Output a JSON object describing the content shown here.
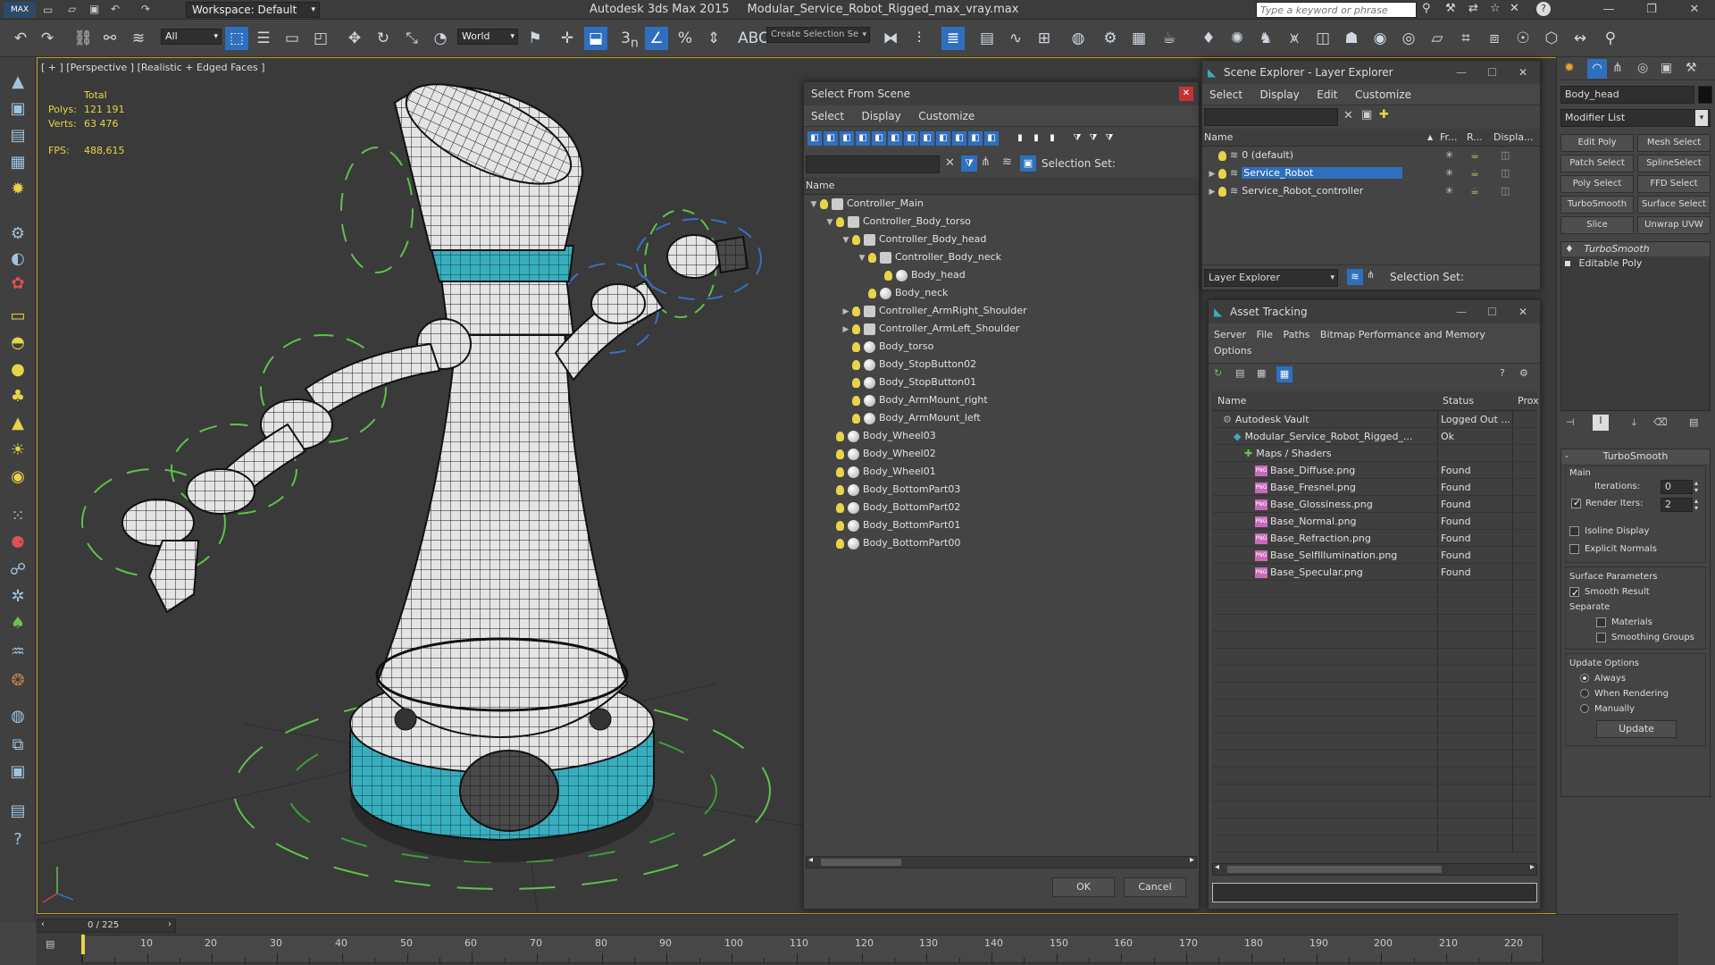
{
  "app": {
    "workspace_label": "Workspace: Default",
    "title": "Autodesk 3ds Max  2015",
    "filename": "Modular_Service_Robot_Rigged_max_vray.max",
    "search_placeholder": "Type a keyword or phrase"
  },
  "toolbar": {
    "filter_value": "All",
    "coord_system": "World",
    "snap_label": "3",
    "selection_set_placeholder": "Create Selection Se"
  },
  "viewport": {
    "label": "[ + ] [Perspective ] [Realistic + Edged Faces ]",
    "stats": {
      "total": "Total",
      "polys_label": "Polys:",
      "polys": "121 191",
      "verts_label": "Verts:",
      "verts": "63 476",
      "fps_label": "FPS:",
      "fps": "488,615"
    }
  },
  "select_from_scene": {
    "title": "Select From Scene",
    "menu": [
      "Select",
      "Display",
      "Customize"
    ],
    "selection_set_label": "Selection Set:",
    "column_name": "Name",
    "items": [
      {
        "label": "Controller_Main",
        "indent": 0,
        "expand": "down",
        "icon": "controller"
      },
      {
        "label": "Controller_Body_torso",
        "indent": 1,
        "expand": "down",
        "icon": "controller"
      },
      {
        "label": "Controller_Body_head",
        "indent": 2,
        "expand": "down",
        "icon": "controller"
      },
      {
        "label": "Controller_Body_neck",
        "indent": 3,
        "expand": "down",
        "icon": "controller"
      },
      {
        "label": "Body_head",
        "indent": 4,
        "expand": "none",
        "icon": "mesh"
      },
      {
        "label": "Body_neck",
        "indent": 3,
        "expand": "none",
        "icon": "mesh"
      },
      {
        "label": "Controller_ArmRight_Shoulder",
        "indent": 2,
        "expand": "right",
        "icon": "controller"
      },
      {
        "label": "Controller_ArmLeft_Shoulder",
        "indent": 2,
        "expand": "right",
        "icon": "controller"
      },
      {
        "label": "Body_torso",
        "indent": 2,
        "expand": "none",
        "icon": "mesh"
      },
      {
        "label": "Body_StopButton02",
        "indent": 2,
        "expand": "none",
        "icon": "mesh"
      },
      {
        "label": "Body_StopButton01",
        "indent": 2,
        "expand": "none",
        "icon": "mesh"
      },
      {
        "label": "Body_ArmMount_right",
        "indent": 2,
        "expand": "none",
        "icon": "mesh"
      },
      {
        "label": "Body_ArmMount_left",
        "indent": 2,
        "expand": "none",
        "icon": "mesh"
      },
      {
        "label": "Body_Wheel03",
        "indent": 1,
        "expand": "none",
        "icon": "mesh"
      },
      {
        "label": "Body_Wheel02",
        "indent": 1,
        "expand": "none",
        "icon": "mesh"
      },
      {
        "label": "Body_Wheel01",
        "indent": 1,
        "expand": "none",
        "icon": "mesh"
      },
      {
        "label": "Body_BottomPart03",
        "indent": 1,
        "expand": "none",
        "icon": "mesh"
      },
      {
        "label": "Body_BottomPart02",
        "indent": 1,
        "expand": "none",
        "icon": "mesh"
      },
      {
        "label": "Body_BottomPart01",
        "indent": 1,
        "expand": "none",
        "icon": "mesh"
      },
      {
        "label": "Body_BottomPart00",
        "indent": 1,
        "expand": "none",
        "icon": "mesh"
      }
    ],
    "ok": "OK",
    "cancel": "Cancel"
  },
  "scene_explorer": {
    "title": "Scene Explorer - Layer Explorer",
    "menu": [
      "Select",
      "Display",
      "Edit",
      "Customize"
    ],
    "columns": [
      "Name",
      "Fr...",
      "R...",
      "Displa..."
    ],
    "layers": [
      {
        "label": "0 (default)",
        "selected": false,
        "expand": false
      },
      {
        "label": "Service_Robot",
        "selected": true,
        "expand": true
      },
      {
        "label": "Service_Robot_controller",
        "selected": false,
        "expand": true
      }
    ],
    "explorer_dropdown": "Layer Explorer",
    "selection_set_label": "Selection Set:"
  },
  "asset_tracking": {
    "title": "Asset Tracking",
    "menu": [
      "Server",
      "File",
      "Paths",
      "Bitmap Performance and Memory",
      "Options"
    ],
    "columns": [
      "Name",
      "Status",
      "Prox"
    ],
    "rows": [
      {
        "name": "Autodesk Vault",
        "status": "Logged Out ...",
        "indent": 1,
        "icon": "vault"
      },
      {
        "name": "Modular_Service_Robot_Rigged_...",
        "status": "Ok",
        "indent": 2,
        "icon": "maxfile"
      },
      {
        "name": "Maps / Shaders",
        "status": "",
        "indent": 3,
        "icon": "maps"
      },
      {
        "name": "Base_Diffuse.png",
        "status": "Found",
        "indent": 4,
        "icon": "png"
      },
      {
        "name": "Base_Fresnel.png",
        "status": "Found",
        "indent": 4,
        "icon": "png"
      },
      {
        "name": "Base_Glossiness.png",
        "status": "Found",
        "indent": 4,
        "icon": "png"
      },
      {
        "name": "Base_Normal.png",
        "status": "Found",
        "indent": 4,
        "icon": "png"
      },
      {
        "name": "Base_Refraction.png",
        "status": "Found",
        "indent": 4,
        "icon": "png"
      },
      {
        "name": "Base_SelfIllumination.png",
        "status": "Found",
        "indent": 4,
        "icon": "png"
      },
      {
        "name": "Base_Specular.png",
        "status": "Found",
        "indent": 4,
        "icon": "png"
      }
    ],
    "png_badge": "PNG"
  },
  "command_panel": {
    "object_name": "Body_head",
    "modifier_list": "Modifier List",
    "buttons": [
      "Edit Poly",
      "Mesh Select",
      "Patch Select",
      "SplineSelect",
      "Poly Select",
      "FFD Select",
      "TurboSmooth",
      "Surface Select",
      "Slice",
      "Unwrap UVW"
    ],
    "stack": [
      "TurboSmooth",
      "Editable Poly"
    ],
    "rollout_title": "TurboSmooth",
    "main_label": "Main",
    "iterations_label": "Iterations:",
    "iterations": "0",
    "render_iters_label": "Render Iters:",
    "render_iters": "2",
    "isoline": "Isoline Display",
    "explicit_normals": "Explicit Normals",
    "surface_params": "Surface Parameters",
    "smooth_result": "Smooth Result",
    "separate": "Separate",
    "materials": "Materials",
    "smoothing_groups": "Smoothing Groups",
    "update_options": "Update Options",
    "always": "Always",
    "when_rendering": "When Rendering",
    "manually": "Manually",
    "update_button": "Update"
  },
  "timeline": {
    "frame_counter": "0 / 225",
    "ticks": [
      "10",
      "20",
      "30",
      "40",
      "50",
      "60",
      "70",
      "80",
      "90",
      "100",
      "110",
      "120",
      "130",
      "140",
      "150",
      "160",
      "170",
      "180",
      "190",
      "200",
      "210",
      "220"
    ]
  },
  "colors": {
    "accent": "#2f6fbf",
    "viewport_border": "#b9a020",
    "bulb": "#e8d448",
    "wire": "#1a1a1a",
    "teal": "#38aebd",
    "gizmo_green": "#5ec24a",
    "gizmo_blue": "#3a6fc4"
  }
}
